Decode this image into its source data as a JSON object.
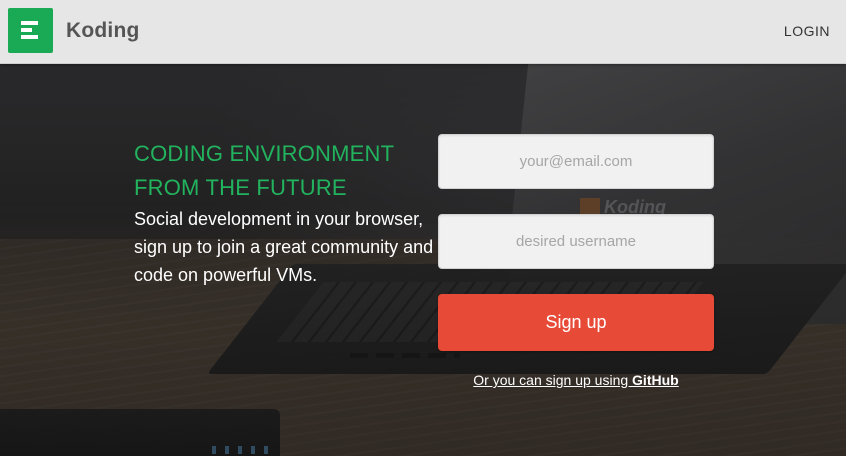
{
  "header": {
    "brand": "Koding",
    "login_label": "LOGIN",
    "logo_icon": "koding-logo-icon",
    "logo_color": "#1aaa55"
  },
  "hero": {
    "headline_line1": "CODING ENVIRONMENT",
    "headline_line2": "FROM THE FUTURE",
    "headline_color": "#22b35e",
    "tagline": "Social development in your browser, sign up to join a great community and code on powerful VMs.",
    "background_image": "laptop on wooden desk (darkened photo)"
  },
  "form": {
    "email_placeholder": "your@email.com",
    "email_value": "",
    "username_placeholder": "desired username",
    "username_value": "",
    "signup_label": "Sign up",
    "signup_color": "#e84a38",
    "alt_signup_prefix": "Or you can sign up using ",
    "alt_signup_provider": "GitHub"
  }
}
